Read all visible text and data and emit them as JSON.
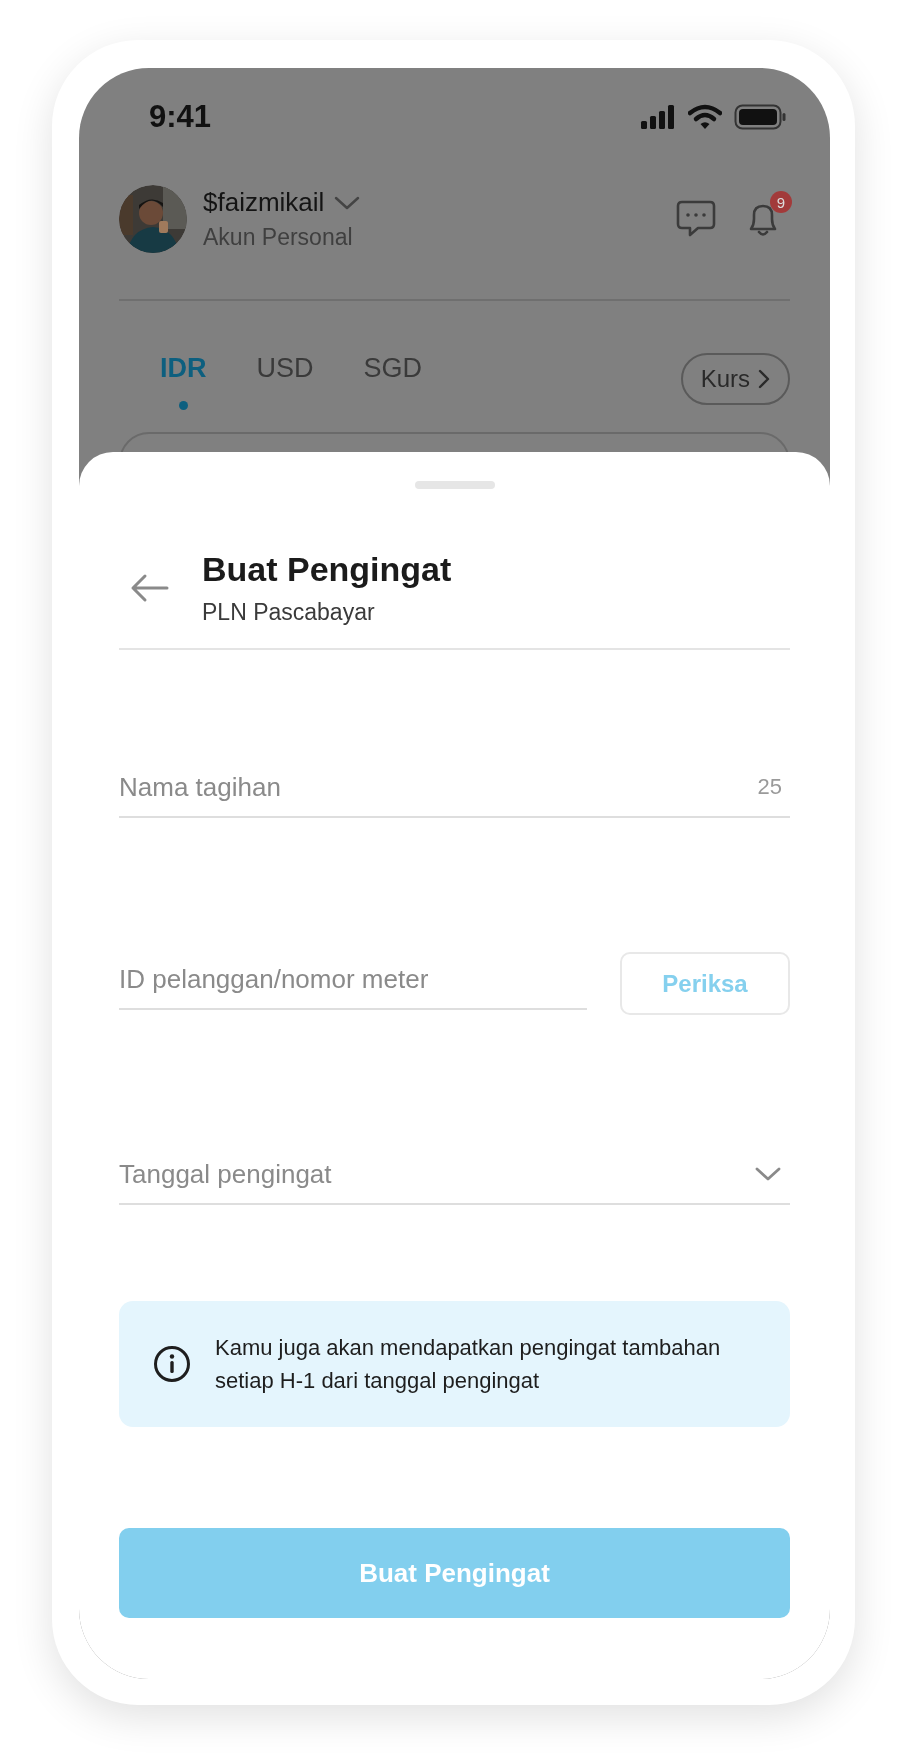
{
  "status_bar": {
    "time": "9:41"
  },
  "account": {
    "username": "$faizmikail",
    "type": "Akun Personal",
    "notification_count": "9"
  },
  "currency_tabs": [
    {
      "label": "IDR",
      "selected": true
    },
    {
      "label": "USD",
      "selected": false
    },
    {
      "label": "SGD",
      "selected": false
    }
  ],
  "rate_button": {
    "label": "Kurs"
  },
  "sheet": {
    "title": "Buat Pengingat",
    "subtitle": "PLN Pascabayar",
    "fields": [
      {
        "kind": "text",
        "placeholder": "Nama tagihan",
        "counter": "25"
      },
      {
        "kind": "check",
        "placeholder": "ID pelanggan/nomor meter",
        "action": "Periksa"
      },
      {
        "kind": "dropdown",
        "placeholder": "Tanggal pengingat"
      }
    ],
    "info": "Kamu juga akan mendapatkan pengingat tambahan setiap H-1 dari tanggal pengingat",
    "submit": {
      "label": "Buat Pengingat",
      "disabled": true
    }
  }
}
